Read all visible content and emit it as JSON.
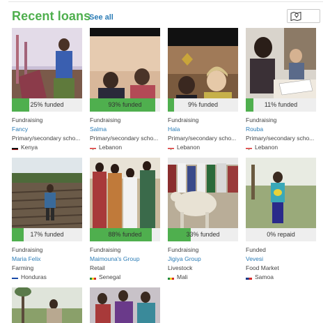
{
  "header": {
    "title": "Recent loans",
    "see_all": "See all"
  },
  "loans": [
    {
      "progress": 0.25,
      "progress_label": "25% funded",
      "status": "Fundraising",
      "name": "Fancy",
      "sector": "Primary/secondary scho...",
      "country": "Kenya"
    },
    {
      "progress": 0.93,
      "progress_label": "93% funded",
      "status": "Fundraising",
      "name": "Salma",
      "sector": "Primary/secondary scho...",
      "country": "Lebanon"
    },
    {
      "progress": 0.09,
      "progress_label": "9% funded",
      "status": "Fundraising",
      "name": "Hala",
      "sector": "Primary/secondary scho...",
      "country": "Lebanon"
    },
    {
      "progress": 0.11,
      "progress_label": "11% funded",
      "status": "Fundraising",
      "name": "Rouba",
      "sector": "Primary/secondary scho...",
      "country": "Lebanon"
    },
    {
      "progress": 0.17,
      "progress_label": "17% funded",
      "status": "Fundraising",
      "name": "Maria Felix",
      "sector": "Farming",
      "country": "Honduras"
    },
    {
      "progress": 0.88,
      "progress_label": "88% funded",
      "status": "Fundraising",
      "name": "Maimouna's Group",
      "sector": "Retail",
      "country": "Senegal"
    },
    {
      "progress": 0.33,
      "progress_label": "33% funded",
      "status": "Fundraising",
      "name": "Jigiya Group",
      "sector": "Livestock",
      "country": "Mali"
    },
    {
      "progress": 0.0,
      "progress_label": "0% repaid",
      "status": "Funded",
      "name": "Vevesi",
      "sector": "Food Market",
      "country": "Samoa"
    }
  ],
  "icons": {
    "map_view": "map-icon",
    "grid_view": "grid-icon"
  },
  "colors": {
    "accent": "#4faf4e",
    "link": "#2b7cb6"
  }
}
